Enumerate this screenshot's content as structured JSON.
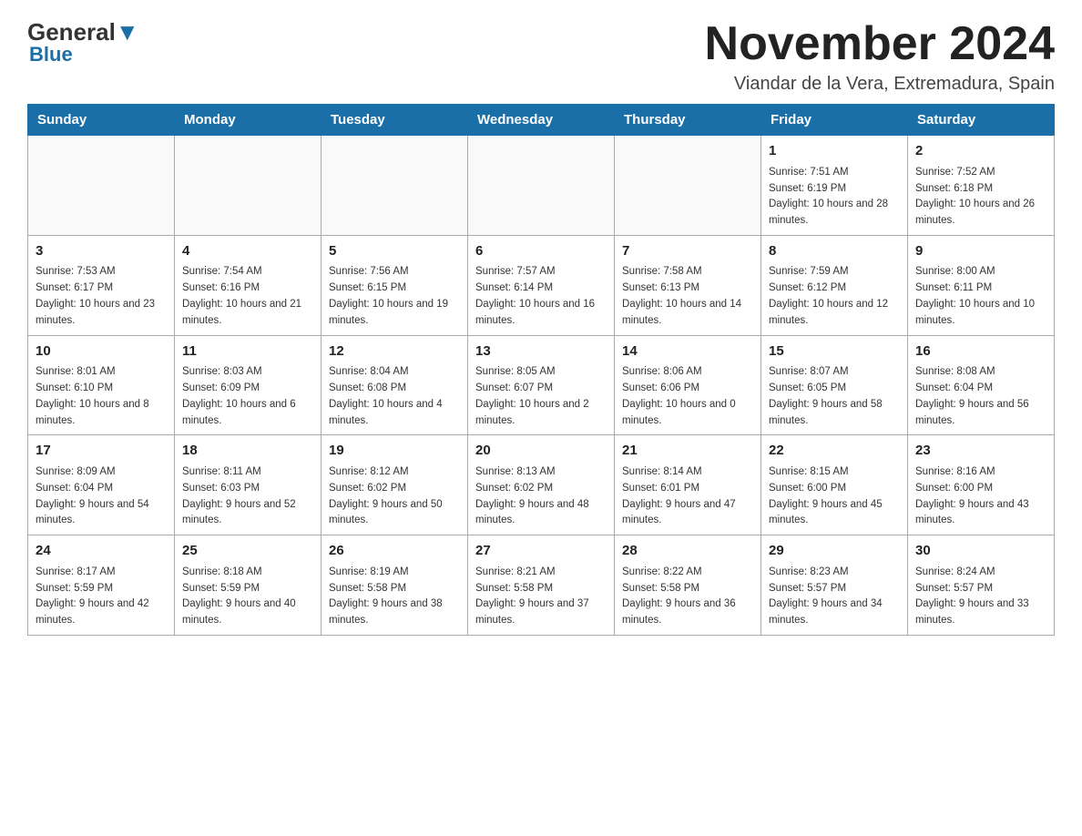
{
  "logo": {
    "general": "General",
    "triangle": "",
    "blue": "Blue"
  },
  "header": {
    "month": "November 2024",
    "location": "Viandar de la Vera, Extremadura, Spain"
  },
  "days_of_week": [
    "Sunday",
    "Monday",
    "Tuesday",
    "Wednesday",
    "Thursday",
    "Friday",
    "Saturday"
  ],
  "weeks": [
    [
      {
        "day": "",
        "info": ""
      },
      {
        "day": "",
        "info": ""
      },
      {
        "day": "",
        "info": ""
      },
      {
        "day": "",
        "info": ""
      },
      {
        "day": "",
        "info": ""
      },
      {
        "day": "1",
        "info": "Sunrise: 7:51 AM\nSunset: 6:19 PM\nDaylight: 10 hours and 28 minutes."
      },
      {
        "day": "2",
        "info": "Sunrise: 7:52 AM\nSunset: 6:18 PM\nDaylight: 10 hours and 26 minutes."
      }
    ],
    [
      {
        "day": "3",
        "info": "Sunrise: 7:53 AM\nSunset: 6:17 PM\nDaylight: 10 hours and 23 minutes."
      },
      {
        "day": "4",
        "info": "Sunrise: 7:54 AM\nSunset: 6:16 PM\nDaylight: 10 hours and 21 minutes."
      },
      {
        "day": "5",
        "info": "Sunrise: 7:56 AM\nSunset: 6:15 PM\nDaylight: 10 hours and 19 minutes."
      },
      {
        "day": "6",
        "info": "Sunrise: 7:57 AM\nSunset: 6:14 PM\nDaylight: 10 hours and 16 minutes."
      },
      {
        "day": "7",
        "info": "Sunrise: 7:58 AM\nSunset: 6:13 PM\nDaylight: 10 hours and 14 minutes."
      },
      {
        "day": "8",
        "info": "Sunrise: 7:59 AM\nSunset: 6:12 PM\nDaylight: 10 hours and 12 minutes."
      },
      {
        "day": "9",
        "info": "Sunrise: 8:00 AM\nSunset: 6:11 PM\nDaylight: 10 hours and 10 minutes."
      }
    ],
    [
      {
        "day": "10",
        "info": "Sunrise: 8:01 AM\nSunset: 6:10 PM\nDaylight: 10 hours and 8 minutes."
      },
      {
        "day": "11",
        "info": "Sunrise: 8:03 AM\nSunset: 6:09 PM\nDaylight: 10 hours and 6 minutes."
      },
      {
        "day": "12",
        "info": "Sunrise: 8:04 AM\nSunset: 6:08 PM\nDaylight: 10 hours and 4 minutes."
      },
      {
        "day": "13",
        "info": "Sunrise: 8:05 AM\nSunset: 6:07 PM\nDaylight: 10 hours and 2 minutes."
      },
      {
        "day": "14",
        "info": "Sunrise: 8:06 AM\nSunset: 6:06 PM\nDaylight: 10 hours and 0 minutes."
      },
      {
        "day": "15",
        "info": "Sunrise: 8:07 AM\nSunset: 6:05 PM\nDaylight: 9 hours and 58 minutes."
      },
      {
        "day": "16",
        "info": "Sunrise: 8:08 AM\nSunset: 6:04 PM\nDaylight: 9 hours and 56 minutes."
      }
    ],
    [
      {
        "day": "17",
        "info": "Sunrise: 8:09 AM\nSunset: 6:04 PM\nDaylight: 9 hours and 54 minutes."
      },
      {
        "day": "18",
        "info": "Sunrise: 8:11 AM\nSunset: 6:03 PM\nDaylight: 9 hours and 52 minutes."
      },
      {
        "day": "19",
        "info": "Sunrise: 8:12 AM\nSunset: 6:02 PM\nDaylight: 9 hours and 50 minutes."
      },
      {
        "day": "20",
        "info": "Sunrise: 8:13 AM\nSunset: 6:02 PM\nDaylight: 9 hours and 48 minutes."
      },
      {
        "day": "21",
        "info": "Sunrise: 8:14 AM\nSunset: 6:01 PM\nDaylight: 9 hours and 47 minutes."
      },
      {
        "day": "22",
        "info": "Sunrise: 8:15 AM\nSunset: 6:00 PM\nDaylight: 9 hours and 45 minutes."
      },
      {
        "day": "23",
        "info": "Sunrise: 8:16 AM\nSunset: 6:00 PM\nDaylight: 9 hours and 43 minutes."
      }
    ],
    [
      {
        "day": "24",
        "info": "Sunrise: 8:17 AM\nSunset: 5:59 PM\nDaylight: 9 hours and 42 minutes."
      },
      {
        "day": "25",
        "info": "Sunrise: 8:18 AM\nSunset: 5:59 PM\nDaylight: 9 hours and 40 minutes."
      },
      {
        "day": "26",
        "info": "Sunrise: 8:19 AM\nSunset: 5:58 PM\nDaylight: 9 hours and 38 minutes."
      },
      {
        "day": "27",
        "info": "Sunrise: 8:21 AM\nSunset: 5:58 PM\nDaylight: 9 hours and 37 minutes."
      },
      {
        "day": "28",
        "info": "Sunrise: 8:22 AM\nSunset: 5:58 PM\nDaylight: 9 hours and 36 minutes."
      },
      {
        "day": "29",
        "info": "Sunrise: 8:23 AM\nSunset: 5:57 PM\nDaylight: 9 hours and 34 minutes."
      },
      {
        "day": "30",
        "info": "Sunrise: 8:24 AM\nSunset: 5:57 PM\nDaylight: 9 hours and 33 minutes."
      }
    ]
  ]
}
